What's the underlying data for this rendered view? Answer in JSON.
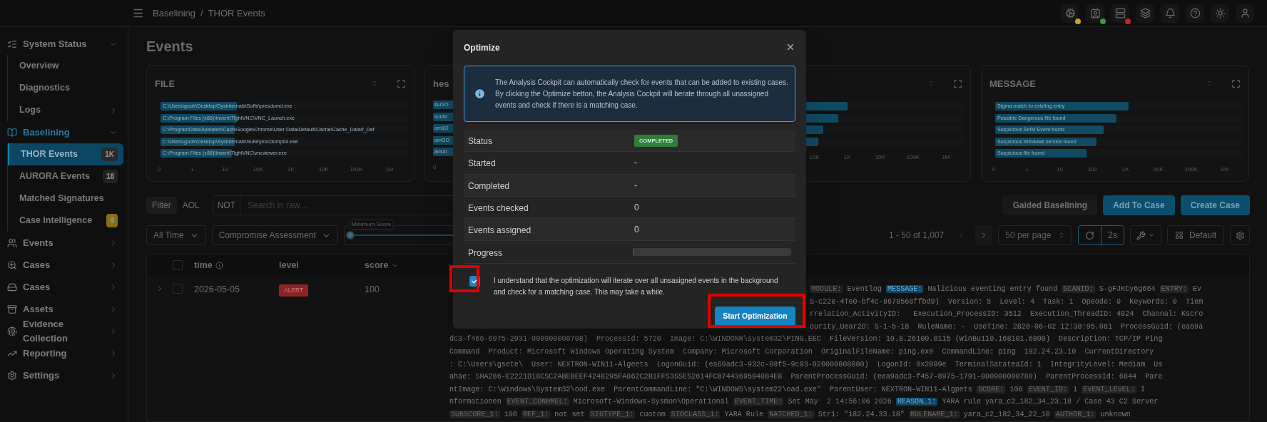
{
  "header": {
    "breadcrumb": [
      "Baselining",
      "/",
      "THOR Events"
    ],
    "icons": [
      {
        "kind": "gear",
        "color": "#c9a227"
      },
      {
        "kind": "contact",
        "color": "#3a9a3e"
      },
      {
        "kind": "server",
        "color": "#c62828"
      },
      {
        "kind": "layers"
      },
      {
        "kind": "bell"
      },
      {
        "kind": "help"
      },
      {
        "kind": "sun"
      },
      {
        "kind": "user"
      }
    ]
  },
  "sidebar": {
    "items": [
      {
        "label": "System Status",
        "kind": "list",
        "expanded": true,
        "selected": false,
        "children": [
          {
            "label": "Overview",
            "selected": false
          },
          {
            "label": "Diagnostics",
            "selected": false
          },
          {
            "label": "Logs",
            "selected": false,
            "has_submenu": true
          }
        ]
      },
      {
        "label": "Baselining",
        "kind": "book",
        "expanded": true,
        "selected": true,
        "children": [
          {
            "label": "THOR Events",
            "selected": true,
            "badge": {
              "text": "1K",
              "color": "#2a2a2a"
            }
          },
          {
            "label": "AURORA Events",
            "selected": false,
            "badge": {
              "text": "18",
              "color": "#222222"
            }
          },
          {
            "label": "Matched Signatures",
            "selected": false
          },
          {
            "label": "Case Intelligence",
            "selected": false,
            "badge": {
              "text": "9",
              "color": "#8a6d12"
            }
          }
        ]
      },
      {
        "label": "Events",
        "kind": "users",
        "expanded": false,
        "selected": false
      },
      {
        "label": "Cases",
        "kind": "search",
        "expanded": false,
        "selected": false
      },
      {
        "label": "Cases",
        "kind": "drive",
        "expanded": false,
        "selected": false
      },
      {
        "label": "Assets",
        "kind": "archive",
        "expanded": false,
        "selected": false
      },
      {
        "label": "Evidence Collection",
        "kind": "fingerprint",
        "expanded": false,
        "selected": false
      },
      {
        "label": "Reporting",
        "kind": "chart",
        "expanded": false,
        "selected": false
      },
      {
        "label": "Settings",
        "kind": "settings",
        "expanded": false,
        "selected": false
      }
    ]
  },
  "page_title": "Events",
  "charts": [
    {
      "title": "FILE",
      "bars": [
        {
          "label": "C:\\Users\\gootr\\Desktop\\Sysinternals\\Softs\\presdumd.exe",
          "level": 0.31
        },
        {
          "label": "C:\\Program Files (x86)\\Invent\\TightVNC\\VNC_Launch.exe",
          "level": 0.31
        },
        {
          "label": "C:\\ProgramData\\Apelaten\\Cach\\Google\\Chrome\\User Data\\Default\\Cache\\Cache_Data\\f_Def",
          "level": 0.3
        },
        {
          "label": "C:\\Users\\gootr\\Desktop\\Sysinternals\\Suite\\procdump64.exe",
          "level": 0.3
        },
        {
          "label": "C:\\Program Files (x86)\\Invent\\TightVNC\\vncviewer.exe",
          "level": 0.29
        }
      ],
      "ticks": [
        "0",
        "1",
        "10",
        "10K",
        "1K",
        "10K",
        "100K",
        "1M"
      ]
    },
    {
      "title": "hes",
      "bar_labels": [
        "sur1O",
        "sonitr",
        "om1O",
        "omOO",
        "ansdr"
      ],
      "ticks": [
        "0"
      ]
    },
    {
      "bars": [
        {
          "level": 0.53
        },
        {
          "level": 0.49
        },
        {
          "level": 0.43
        },
        {
          "level": 0.41
        }
      ],
      "ticks": [
        "10K",
        "1K",
        "10K",
        "100K",
        "1M"
      ]
    },
    {
      "title": "MESSAGE",
      "bars": [
        {
          "label": "Sigma match to existing entry",
          "level": 0.54
        },
        {
          "label": "Possible Dangerous file found",
          "level": 0.49
        },
        {
          "label": "Suspicious SnIM Event found",
          "level": 0.44
        },
        {
          "label": "Suspicious Windows service found",
          "level": 0.41
        },
        {
          "label": "Suspicious file found",
          "level": 0.37
        }
      ],
      "ticks": [
        "0",
        "1",
        "10",
        "102",
        "1K",
        "10K",
        "100K",
        "1M"
      ]
    }
  ],
  "filter_bar": {
    "modes": [
      {
        "label": "Filter",
        "selected": true
      },
      {
        "label": "AOL",
        "selected": false
      }
    ],
    "not_label": "NOT",
    "search_placeholder": "Search in raw....",
    "actions": [
      {
        "label": "Gaided Baselining",
        "kind": "secondary"
      },
      {
        "label": "Add To Case",
        "kind": "primary"
      },
      {
        "label": "Create Case",
        "kind": "primary"
      }
    ]
  },
  "controls": {
    "time_range": "All Time",
    "view": "Compromise Assessment",
    "min_score": {
      "label": "Minimum Score",
      "level": 0
    },
    "pagination": "1 - 50 of 1,007",
    "prev_disabled": true,
    "per_page": "50 per page",
    "refresh_interval": "2s",
    "layout": "Default"
  },
  "table": {
    "all_checked": false,
    "columns": [
      {
        "label": "time",
        "kind": "info"
      },
      {
        "label": "level",
        "kind": "plain"
      },
      {
        "label": "score",
        "kind": "sort"
      }
    ],
    "rows": [
      {
        "checked": false,
        "time": "2026-05-05",
        "level": {
          "text": "ALERT",
          "color": "#8e2323"
        },
        "score": "100",
        "message_lines": [
          {
            "covered": true,
            "segments": [
              {
                "kind": "key",
                "text": "MODULE:"
              },
              {
                "kind": "text",
                "text": " Eventlog "
              },
              {
                "kind": "match",
                "text": "MESSAGE:"
              },
              {
                "kind": "text",
                "text": " Nalicious eventing entry found "
              },
              {
                "kind": "key",
                "text": "SCANID:"
              },
              {
                "kind": "text",
                "text": " S-gFJKCy6g664 "
              },
              {
                "kind": "key",
                "text": "ENTRY:"
              },
              {
                "kind": "text",
                "text": " Ev"
              }
            ]
          },
          {
            "covered": true,
            "segments": [
              {
                "kind": "text",
                "text": "S-c22e-4Te0-bf4c-8678568ffbd9)  Version: 5  Level: 4  Task: 1  Opeode: 0  Keywords: 0  Tiem"
              }
            ]
          },
          {
            "covered": true,
            "segments": [
              {
                "kind": "text",
                "text": "rrelation_ActivityID:   Execution_ProcessID: 3512  Execution_ThreadID: 4924  Channal: Kscro"
              }
            ]
          },
          {
            "covered": true,
            "segments": [
              {
                "kind": "text",
                "text": "ourity_Uear2D: S-1-5-18  RuleName: -  UseTine: 2828-06-02 12:38:95.081  ProcessGuid: (ea69a"
              }
            ]
          },
          {
            "covered": false,
            "segments": [
              {
                "kind": "text",
                "text": "dc3-f466-6975-2931-000900008708)  ProcessId: 5720  Image: C:\\WINDONR\\system32\\PING.EEC  FileVersion: 10.8.26100.8115 (WinBu110.168101.6800)  Description: TCP/IP Ping"
              }
            ]
          },
          {
            "covered": false,
            "segments": [
              {
                "kind": "text",
                "text": "Command  Product: Microsoft Windows Operating System  Company: Microsoft Corporation  OriginalFileName: ping.exe  CommandLine: ping  192.24.23.10  CurrentDirectory"
              }
            ]
          },
          {
            "covered": false,
            "segments": [
              {
                "kind": "text",
                "text": ": C:\\Users\\gsete\\  User: NEXTRON-WIN11-Algeets  LogonGuid: (ea69adc3-932c-89f5-9c93-020000808080)  LogonId: 0x2899e  TerminalSatateaId: 1  IntegrityLevel: Mediam  Us"
              }
            ]
          },
          {
            "covered": false,
            "segments": [
              {
                "kind": "text",
                "text": "ahae: SHA286-E2221D18CSC2ABEBEEF4248295FA862C2B1FFS3SSES2614FCB744369594084E8  ParentProcessGuid: (eea9adc3-f457-8975-1791-000900000780)  ParentProcessId: 6844  Pare"
              }
            ]
          },
          {
            "covered": false,
            "segments": [
              {
                "kind": "text",
                "text": "ntImage: C:\\Windows\\System32\\ood.exe  ParentCommandLine: \"C:\\WINDOWS\\system22\\oad.exe\"  ParentUser: NEXTRON-WIN11-Algpets "
              },
              {
                "kind": "key",
                "text": "SCORE:"
              },
              {
                "kind": "text",
                "text": " 108 "
              },
              {
                "kind": "key",
                "text": "EVENT_ID:"
              },
              {
                "kind": "text",
                "text": " 1 "
              },
              {
                "kind": "key",
                "text": "EVENT_LEVEL:"
              },
              {
                "kind": "text",
                "text": " I"
              }
            ]
          },
          {
            "covered": false,
            "segments": [
              {
                "kind": "text",
                "text": "nformationen "
              },
              {
                "kind": "key",
                "text": "EVENT_CONHMEL:"
              },
              {
                "kind": "text",
                "text": " Microsoft-Windows-Sysmon\\Operational "
              },
              {
                "kind": "key",
                "text": "EVENT_TIME:"
              },
              {
                "kind": "text",
                "text": " Set May  2 14:56:06 2026 "
              },
              {
                "kind": "match",
                "text": "REASON_1:"
              },
              {
                "kind": "text",
                "text": " YARA rule yara_c2_182_34_23.18 / Case 43 C2 Server"
              }
            ]
          },
          {
            "covered": false,
            "segments": [
              {
                "kind": "key",
                "text": "SUBSCORE_1:"
              },
              {
                "kind": "text",
                "text": " 100 "
              },
              {
                "kind": "key",
                "text": "REF_1:"
              },
              {
                "kind": "text",
                "text": " not set "
              },
              {
                "kind": "key",
                "text": "SIGTYPE_1:"
              },
              {
                "kind": "text",
                "text": " cuotom "
              },
              {
                "kind": "key",
                "text": "SIOCLASS_1:"
              },
              {
                "kind": "text",
                "text": " YARA Rule "
              },
              {
                "kind": "key",
                "text": "NATCHED_1:"
              },
              {
                "kind": "text",
                "text": " Str1: \"182.24.33.18\" "
              },
              {
                "kind": "key",
                "text": "RULENAME_1:"
              },
              {
                "kind": "text",
                "text": " yara_c2_182_34_22_10 "
              },
              {
                "kind": "key",
                "text": "AUTHOR_1:"
              },
              {
                "kind": "text",
                "text": " unknown"
              }
            ]
          }
        ]
      }
    ]
  },
  "dialog": {
    "title": "Optimize",
    "info": "The Analysis Cockpit can automatically check for events that can be added to existing cases. By clicking the Optimize betton, the Analysis Cockpit will berate through all unassigned events and check if there is a matching case.",
    "rows": [
      {
        "label": "Status",
        "kind": "badge",
        "value": "COMPLETED"
      },
      {
        "label": "Started",
        "kind": "text",
        "value": "-"
      },
      {
        "label": "Completed",
        "kind": "text",
        "value": "-"
      },
      {
        "label": "Events checked",
        "kind": "text",
        "value": "0"
      },
      {
        "label": "Events assigned",
        "kind": "text",
        "value": "0"
      },
      {
        "label": "Progress",
        "kind": "progress",
        "level": 0
      }
    ],
    "consent": {
      "checked": true,
      "highlighted": true,
      "text": "I understand that the optimization will iterate over all unsasigned events in the background and check for a matching case. This may take a while."
    },
    "start_button": {
      "label": "Start Optimization",
      "highlighted": true
    }
  }
}
